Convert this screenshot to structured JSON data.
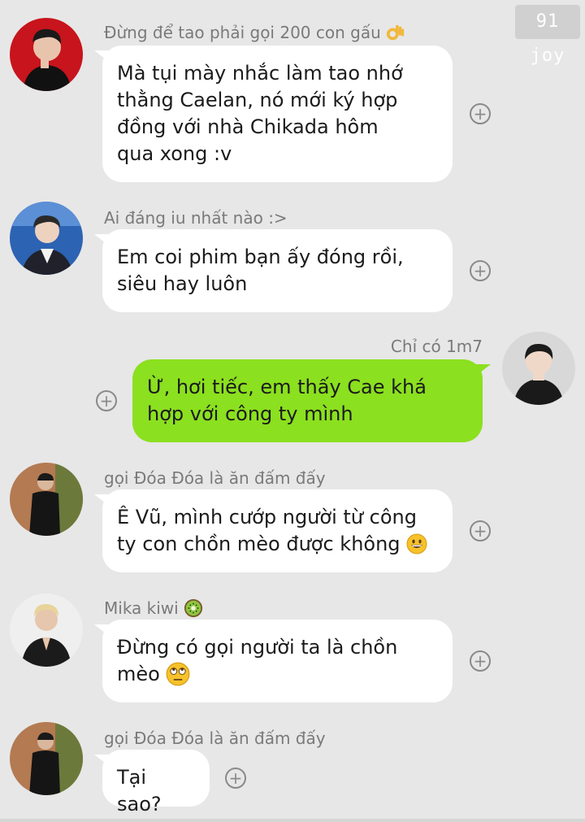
{
  "watermark": "91 joy",
  "messages": [
    {
      "sender": "Đừng để tao phải gọi 200 con gấu",
      "sender_emoji": "ok-hand-emoji",
      "lines": [
        "Mà tụi mày nhắc làm tao nhớ",
        "thằng Caelan, nó mới ký hợp",
        "đồng với nhà Chikada hôm",
        "qua xong :v"
      ],
      "direction": "incoming"
    },
    {
      "sender": "Ai đáng iu nhất nào :>",
      "lines": [
        "Em coi phim bạn ấy đóng rồi,",
        "siêu hay luôn"
      ],
      "direction": "incoming"
    },
    {
      "sender": "Chỉ có 1m7",
      "lines": [
        "Ừ, hơi tiếc, em thấy Cae khá",
        "hợp với công ty mình"
      ],
      "direction": "outgoing"
    },
    {
      "sender": "gọi Đóa Đóa là ăn đấm đấy",
      "lines": [
        "Ê Vũ, mình cướp người từ công",
        "ty con chồn mèo được không"
      ],
      "line_emoji": "grinning-face-emoji",
      "direction": "incoming"
    },
    {
      "sender": "Mika kiwi",
      "sender_emoji": "kiwi-emoji",
      "lines": [
        "Đừng có gọi người ta là chồn",
        "mèo"
      ],
      "line_emoji": "eye-roll-emoji",
      "direction": "incoming"
    },
    {
      "sender": "gọi Đóa Đóa là ăn đấm đấy",
      "lines": [
        "Tại sao?"
      ],
      "direction": "incoming"
    }
  ],
  "colors": {
    "background": "#e7e7e7",
    "incoming_bubble": "#ffffff",
    "outgoing_bubble": "#8be01f",
    "sender_text": "#7a7a7a"
  },
  "icons": {
    "plus": "+",
    "add_reaction": "plus-circle-icon"
  }
}
